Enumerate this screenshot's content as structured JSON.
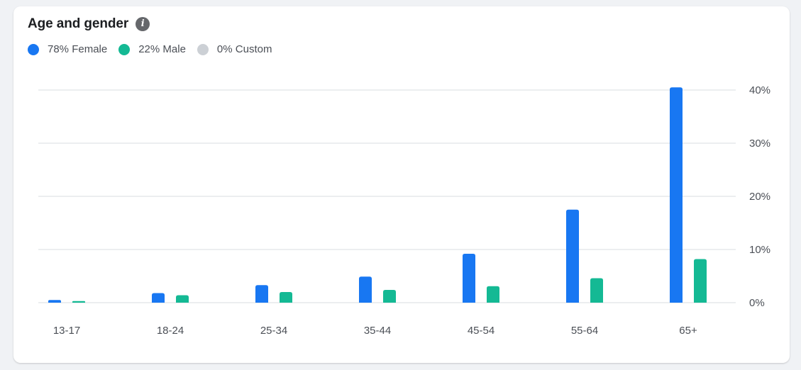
{
  "header": {
    "title": "Age and gender",
    "info_icon": "info-icon"
  },
  "legend": [
    {
      "label": "78% Female",
      "color": "#1877f2"
    },
    {
      "label": "22% Male",
      "color": "#14b994"
    },
    {
      "label": "0% Custom",
      "color": "#ccd0d5"
    }
  ],
  "colors": {
    "grid": "#dadde1",
    "axis_text": "#4b4f56"
  },
  "chart_data": {
    "type": "bar",
    "categories": [
      "13-17",
      "18-24",
      "25-34",
      "35-44",
      "45-54",
      "55-64",
      "65+"
    ],
    "series": [
      {
        "name": "Female",
        "values": [
          0.5,
          1.8,
          3.3,
          4.9,
          9.2,
          17.5,
          40.5
        ]
      },
      {
        "name": "Male",
        "values": [
          0.3,
          1.4,
          2.0,
          2.4,
          3.1,
          4.6,
          8.2
        ]
      },
      {
        "name": "Custom",
        "values": [
          0,
          0,
          0,
          0,
          0,
          0,
          0
        ]
      }
    ],
    "yticks": [
      "0%",
      "10%",
      "20%",
      "30%",
      "40%"
    ],
    "ylim": [
      0,
      40
    ],
    "grid": true,
    "y_axis_position": "right",
    "legend_position": "top-left"
  }
}
